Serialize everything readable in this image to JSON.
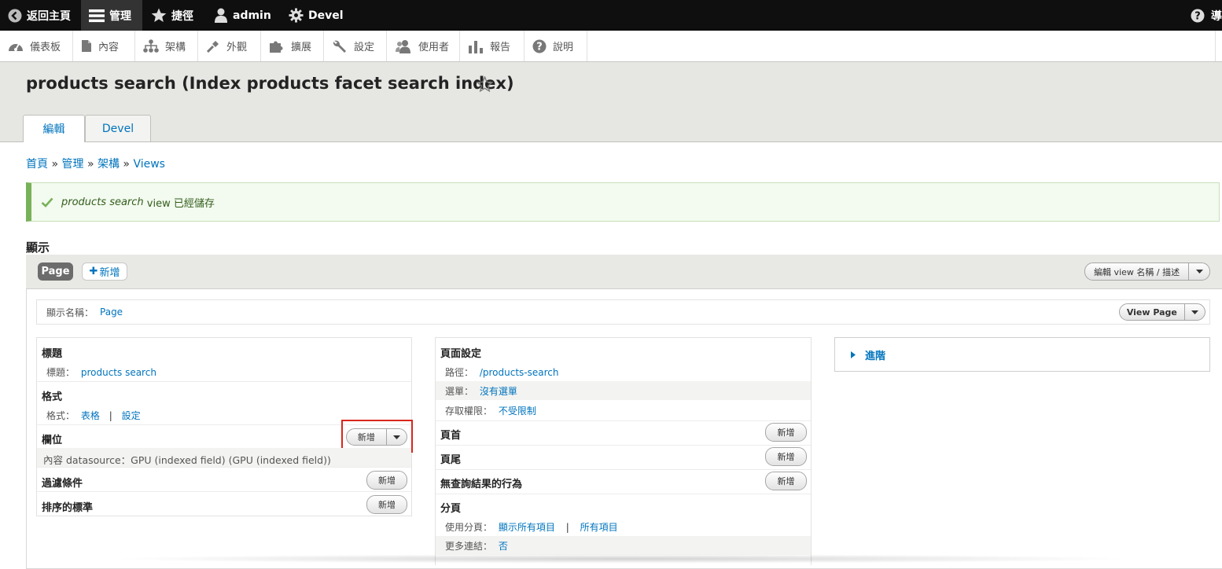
{
  "toolbar": {
    "back_home": "返回主頁",
    "manage": "管理",
    "shortcuts": "捷徑",
    "user": "admin",
    "devel": "Devel",
    "right_label": "導"
  },
  "tray": {
    "items": [
      "儀表板",
      "內容",
      "架構",
      "外觀",
      "擴展",
      "設定",
      "使用者",
      "報告",
      "說明"
    ]
  },
  "header": {
    "title": "products search (Index products facet search index)",
    "tabs": [
      "編輯",
      "Devel"
    ]
  },
  "breadcrumb": [
    "首頁",
    "管理",
    "架構",
    "Views"
  ],
  "breadcrumb_sep": "»",
  "message": {
    "view_name": "products search",
    "text": " view 已經儲存"
  },
  "displays": {
    "label": "顯示",
    "active_tab": "Page",
    "add_label": "新增",
    "edit_view_label": "編輯 view 名稱 / 描述",
    "display_name_label": "顯示名稱：",
    "display_name_value": "Page",
    "view_page_label": "View Page"
  },
  "left_col": {
    "title_head": "標題",
    "title_label": "標題：",
    "title_value": "products search",
    "format_head": "格式",
    "format_label": "格式：",
    "format_value": "表格",
    "format_sep": "|",
    "format_settings": "設定",
    "fields_head": "欄位",
    "fields_add": "新增",
    "field_item": "內容 datasource：GPU (indexed field) (GPU (indexed field))",
    "filters_head": "過濾條件",
    "filters_add": "新增",
    "sort_head": "排序的標準",
    "sort_add": "新增"
  },
  "mid_col": {
    "page_head": "頁面設定",
    "path_label": "路徑：",
    "path_value": "/products-search",
    "menu_label": "選單：",
    "menu_value": "沒有選單",
    "access_label": "存取權限：",
    "access_value": "不受限制",
    "header_head": "頁首",
    "header_add": "新增",
    "footer_head": "頁尾",
    "footer_add": "新增",
    "empty_head": "無查詢結果的行為",
    "empty_add": "新增",
    "pager_head": "分頁",
    "pager_label": "使用分頁：",
    "pager_value": "顯示所有項目",
    "pager_sep": "|",
    "pager_value2": "所有項目",
    "more_label": "更多連結：",
    "more_value": "否"
  },
  "right_col": {
    "advanced": "進階"
  },
  "colors": {
    "link": "#0074bd",
    "toolbar_bg": "#0f0f0f",
    "status_green": "#77b259",
    "highlight": "#d9261c"
  }
}
